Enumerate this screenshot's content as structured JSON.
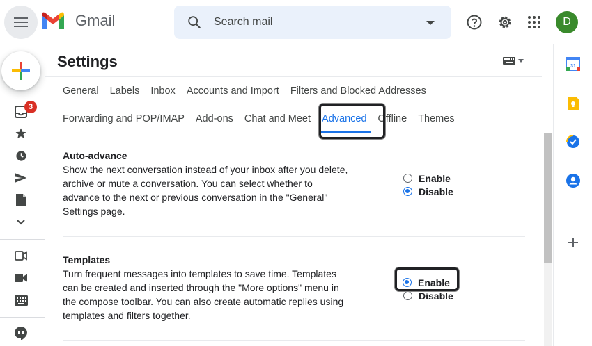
{
  "header": {
    "app_name": "Gmail",
    "search_placeholder": "Search mail",
    "avatar_letter": "D"
  },
  "rail": {
    "inbox_badge": "3"
  },
  "settings": {
    "title": "Settings",
    "tabs_row1": [
      "General",
      "Labels",
      "Inbox",
      "Accounts and Import",
      "Filters and Blocked Addresses"
    ],
    "tabs_row2": [
      "Forwarding and POP/IMAP",
      "Add-ons",
      "Chat and Meet",
      "Advanced",
      "Offline",
      "Themes"
    ],
    "active_tab": "Advanced"
  },
  "sections": {
    "auto_advance": {
      "title": "Auto-advance",
      "description": "Show the next conversation instead of your inbox after you delete, archive or mute a conversation. You can select whether to advance to the next or previous conversation in the \"General\" Settings page.",
      "options": [
        "Enable",
        "Disable"
      ],
      "selected": "Disable"
    },
    "templates": {
      "title": "Templates",
      "description": "Turn frequent messages into templates to save time. Templates can be created and inserted through the \"More options\" menu in the compose toolbar. You can also create automatic replies using templates and filters together.",
      "options": [
        "Enable",
        "Disable"
      ],
      "selected": "Enable"
    }
  },
  "icons": {
    "menu": "menu-icon",
    "search": "search-icon",
    "help": "help-icon",
    "settings": "gear-icon",
    "apps": "apps-grid-icon"
  },
  "colors": {
    "accent": "#1a73e8",
    "badge": "#d93025",
    "avatar": "#3a8a2c",
    "search_bg": "#eaf1fb"
  }
}
